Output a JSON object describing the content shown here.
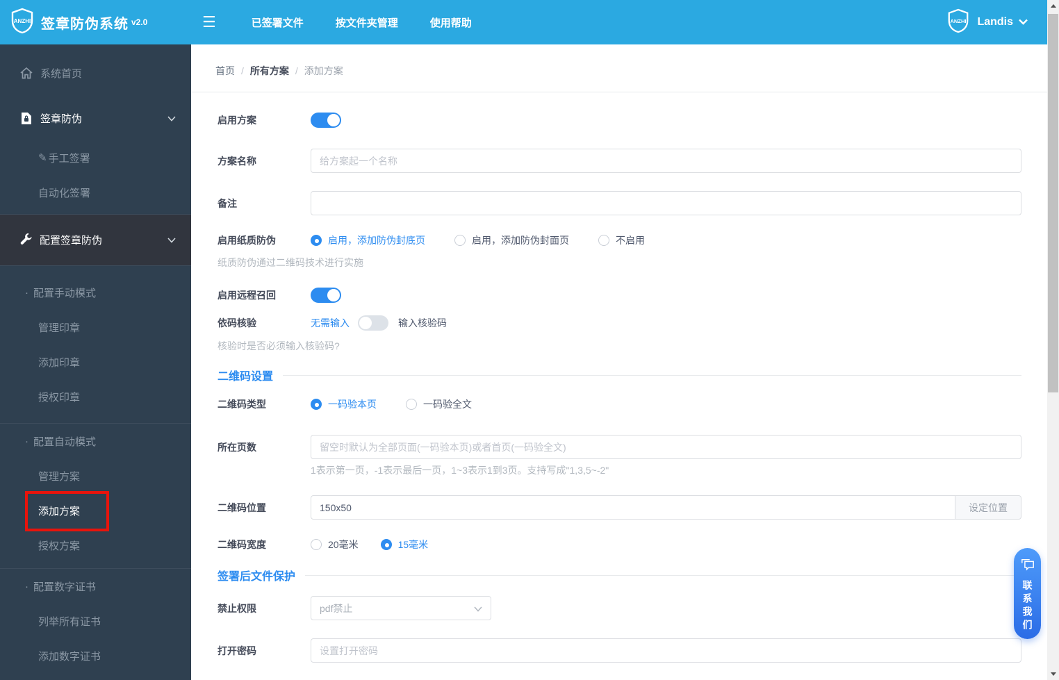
{
  "app": {
    "logo_text": "ANZHI",
    "title": "签章防伪系统",
    "version": "v2.0",
    "user_name": "Landis"
  },
  "topnav": {
    "items": [
      {
        "label": "已签署文件"
      },
      {
        "label": "按文件夹管理"
      },
      {
        "label": "使用帮助"
      }
    ]
  },
  "sidebar": {
    "items": [
      {
        "label": "系统首页"
      },
      {
        "label": "签章防伪"
      },
      {
        "label": "手工签署"
      },
      {
        "label": "自动化签署"
      },
      {
        "label": "配置签章防伪"
      },
      {
        "label": "配置手动模式"
      },
      {
        "label": "管理印章"
      },
      {
        "label": "添加印章"
      },
      {
        "label": "授权印章"
      },
      {
        "label": "配置自动模式"
      },
      {
        "label": "管理方案"
      },
      {
        "label": "添加方案"
      },
      {
        "label": "授权方案"
      },
      {
        "label": "配置数字证书"
      },
      {
        "label": "列举所有证书"
      },
      {
        "label": "添加数字证书"
      }
    ],
    "highlighted_item": "添加方案"
  },
  "breadcrumb": {
    "items": [
      "首页",
      "所有方案",
      "添加方案"
    ],
    "separator": "/"
  },
  "form": {
    "enable_plan": {
      "label": "启用方案",
      "state": "on"
    },
    "plan_name": {
      "label": "方案名称",
      "placeholder": "给方案起一个名称",
      "value": ""
    },
    "remark": {
      "label": "备注",
      "value": ""
    },
    "paper_anti": {
      "label": "启用纸质防伪",
      "options": [
        "启用，添加防伪封底页",
        "启用，添加防伪封面页",
        "不启用"
      ],
      "selected": 0,
      "help": "纸质防伪通过二维码技术进行实施"
    },
    "remote_recall": {
      "label": "启用远程召回",
      "state": "on"
    },
    "code_check": {
      "label": "依码核验",
      "off_label": "无需输入",
      "on_label": "输入核验码",
      "state": "off",
      "help": "核验时是否必须输入核验码?"
    },
    "qr_section_title": "二维码设置",
    "qr_type": {
      "label": "二维码类型",
      "options": [
        "一码验本页",
        "一码验全文"
      ],
      "selected": 0
    },
    "pages": {
      "label": "所在页数",
      "placeholder": "留空时默认为全部页面(一码验本页)或者首页(一码验全文)",
      "value": "",
      "help": "1表示第一页，-1表示最后一页，1~3表示1到3页。支持写成\"1,3,5~-2\""
    },
    "qr_position": {
      "label": "二维码位置",
      "value": "150x50",
      "button": "设定位置"
    },
    "qr_width": {
      "label": "二维码宽度",
      "options": [
        "20毫米",
        "15毫米"
      ],
      "selected": 1
    },
    "protect_section_title": "签署后文件保护",
    "forbid_permission": {
      "label": "禁止权限",
      "value": "pdf禁止"
    },
    "open_password": {
      "label": "打开密码",
      "placeholder": "设置打开密码",
      "value": ""
    }
  },
  "contact": {
    "label": "联系我们"
  },
  "colors": {
    "navbar": "#2BA9E1",
    "sidebar": "#2F4050",
    "sidebar_active_block": "#31353E",
    "accent": "#2d8cf0",
    "highlight_red": "#E8140C",
    "contact_gradient_start": "#4E9BFA",
    "contact_gradient_end": "#2B6CE6"
  }
}
